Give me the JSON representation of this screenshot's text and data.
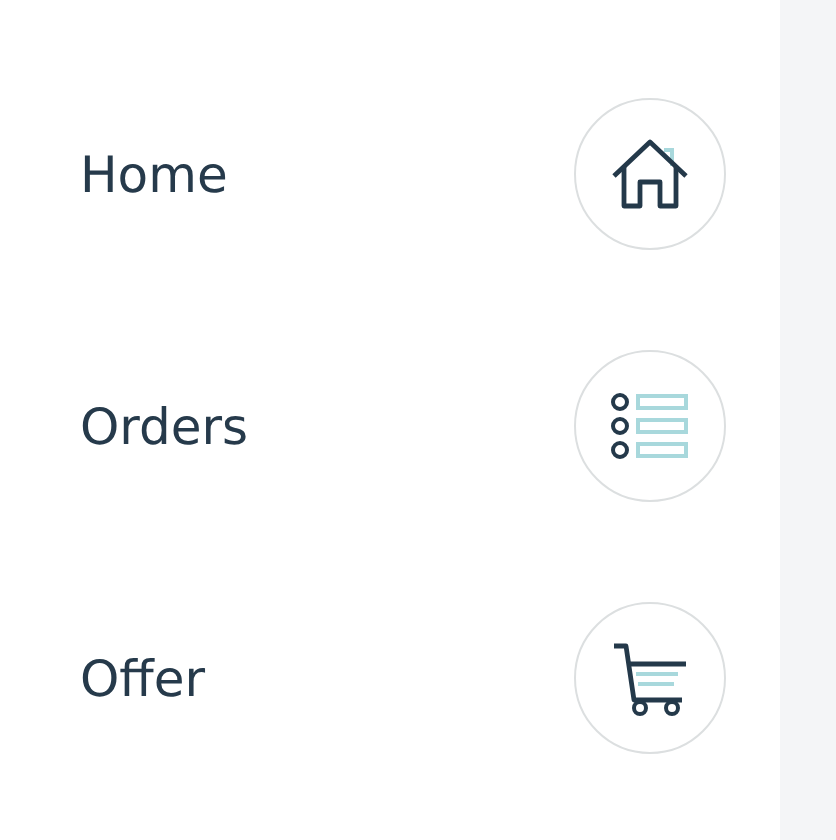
{
  "menu": [
    {
      "label": "Home",
      "kind": "home"
    },
    {
      "label": "Orders",
      "kind": "list"
    },
    {
      "label": "Offer",
      "kind": "cart"
    }
  ]
}
